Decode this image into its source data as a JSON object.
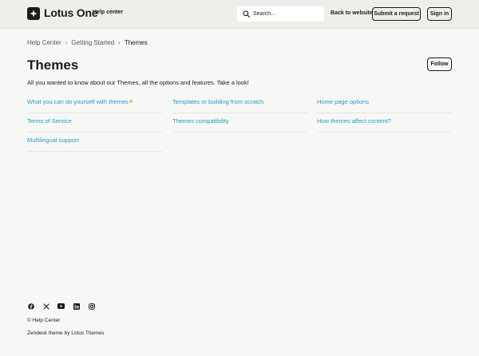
{
  "header": {
    "brand": "Lotus One",
    "help_center_label": "Help center",
    "search_placeholder": "Search...",
    "back_to_website": "Back to website",
    "submit_request": "Submit a request",
    "sign_in": "Sign in"
  },
  "breadcrumb": [
    "Help Center",
    "Getting Started",
    "Themes"
  ],
  "breadcrumb_separator": "›",
  "section": {
    "title": "Themes",
    "follow_label": "Follow",
    "description": "All you wanted to know about our Themes, all the options and features. Take a look!"
  },
  "articles": [
    {
      "title": "What you can do yourself with themes",
      "promoted": true
    },
    {
      "title": "Templates or building from scratch",
      "promoted": false
    },
    {
      "title": "Home page options",
      "promoted": false
    },
    {
      "title": "Terms of Service",
      "promoted": false
    },
    {
      "title": "Themes compatibility",
      "promoted": false
    },
    {
      "title": "How themes affect content?",
      "promoted": false
    },
    {
      "title": "Multilingual support",
      "promoted": false
    }
  ],
  "promoted_symbol": "★",
  "footer": {
    "social_icons": [
      "facebook-icon",
      "x-icon",
      "youtube-icon",
      "linkedin-icon",
      "instagram-icon"
    ],
    "copyright": "© Help Center",
    "theme_credit": "Zendesk theme by Lotus Themes"
  },
  "colors": {
    "header_bg": "#eeeeea",
    "page_bg": "#f7f7f5",
    "link": "#1f9fc9",
    "promoted_star": "#f0a04b",
    "text": "#1b1b1b"
  }
}
